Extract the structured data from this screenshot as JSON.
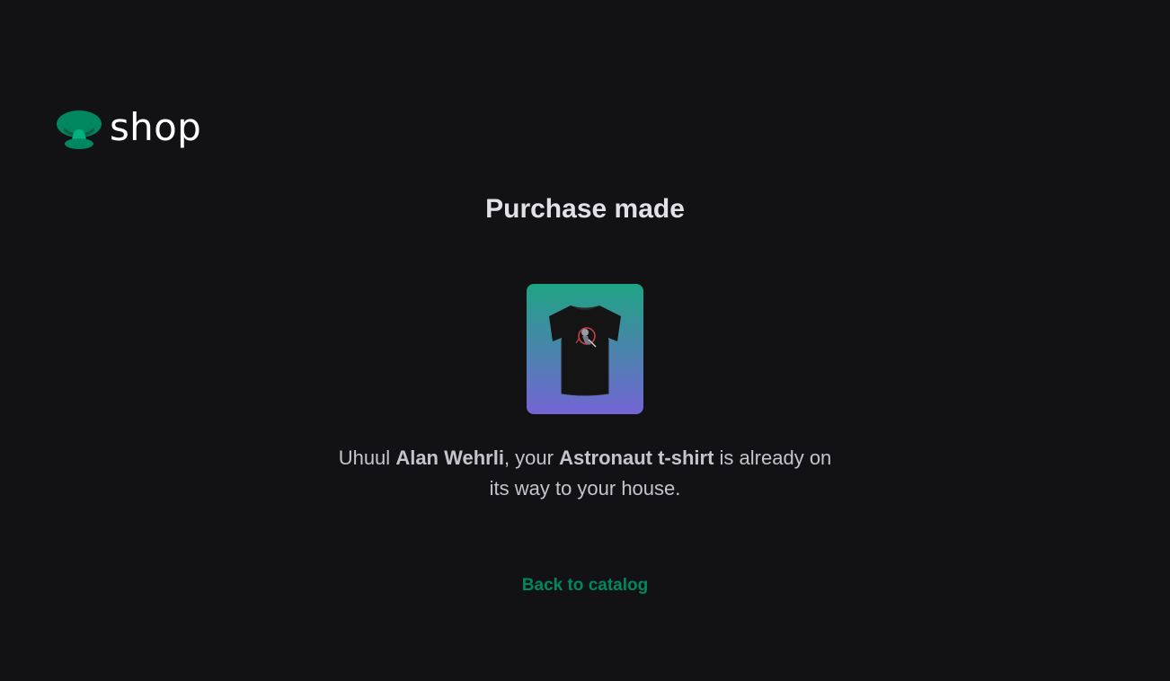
{
  "header": {
    "logo_text": "shop",
    "logo_icon": "mushroom-logo-icon"
  },
  "main": {
    "title": "Purchase made",
    "product_image_icon": "tshirt-icon",
    "message": {
      "greeting": "Uhuul",
      "customer_name": "Alan Wehrli",
      "connector": ", your",
      "product_name": "Astronaut t-shirt",
      "ending": "is already on its way to your house."
    },
    "back_link_label": "Back to catalog"
  },
  "colors": {
    "background": "#121214",
    "brand_green": "#00875f",
    "brand_green_light": "#00b37e",
    "gradient_start": "#1ea483",
    "gradient_end": "#7465d4",
    "title_text": "#e1e1e6",
    "body_text": "#c4c4cc"
  }
}
